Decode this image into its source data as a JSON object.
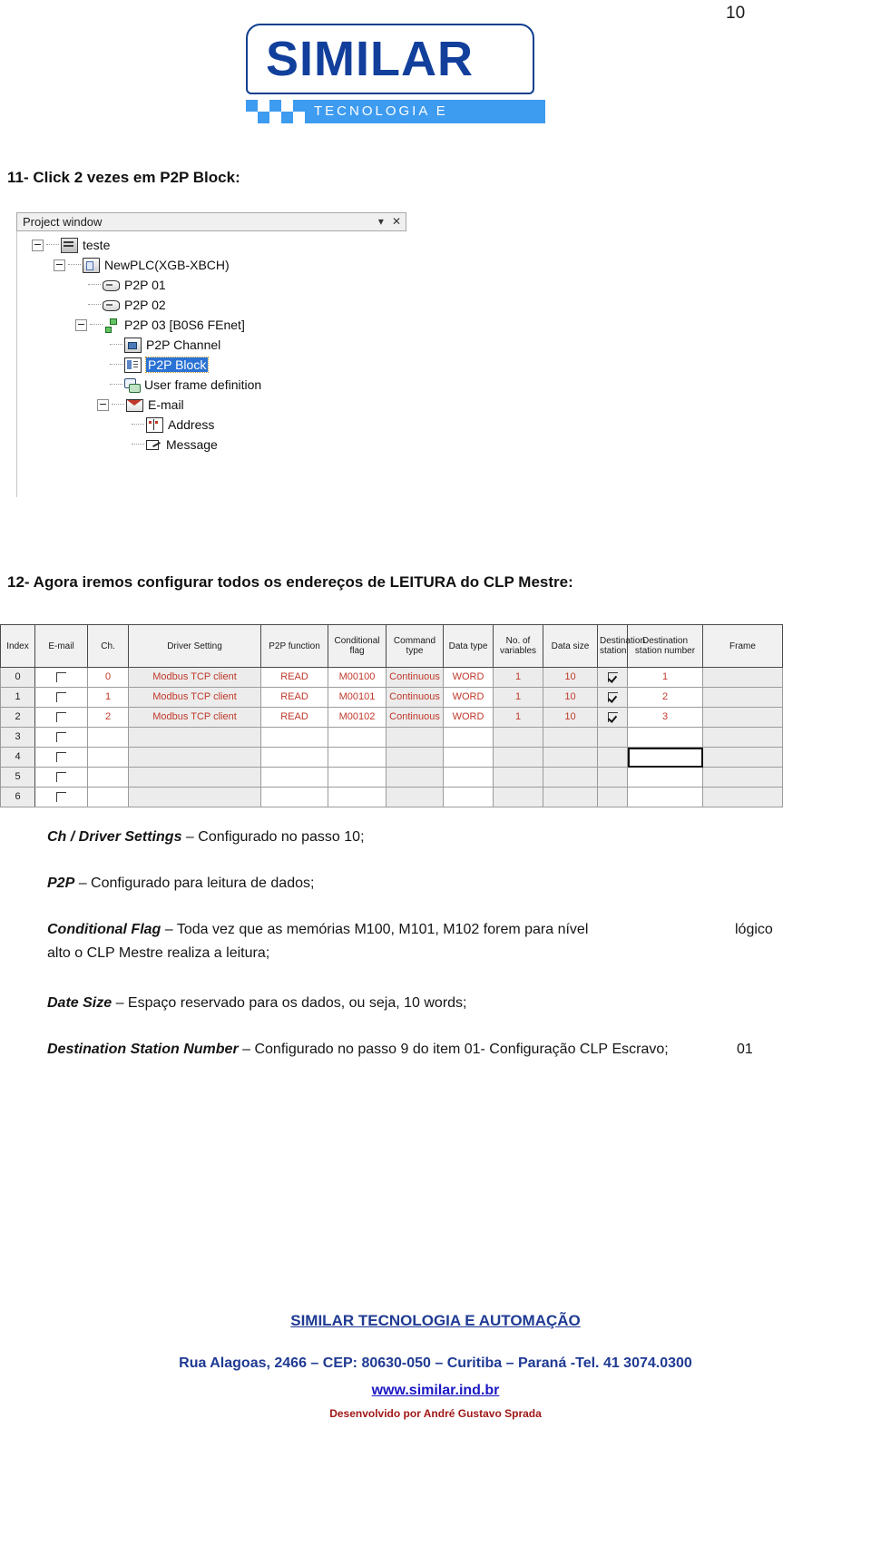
{
  "page": {
    "number": "10"
  },
  "logo": {
    "wordmark": "SIMILAR",
    "tagline": "TECNOLOGIA  E  AUTOMAÇÃO"
  },
  "steps": {
    "step11": "11- Click 2 vezes em P2P Block:",
    "step12": "12- Agora iremos configurar todos os endereços de LEITURA do CLP Mestre:"
  },
  "project_window": {
    "title": "Project window",
    "dropdown_glyph": "▾",
    "close_glyph": "✕",
    "tree": [
      {
        "label": "teste",
        "depth": 0,
        "expander": true,
        "icon": "rack-icon",
        "selected": false
      },
      {
        "label": "NewPLC(XGB-XBCH)",
        "depth": 1,
        "expander": true,
        "icon": "plc-icon",
        "selected": false
      },
      {
        "label": "P2P 01",
        "depth": 2,
        "expander": false,
        "icon": "card-icon",
        "selected": false
      },
      {
        "label": "P2P 02",
        "depth": 2,
        "expander": false,
        "icon": "card-icon",
        "selected": false
      },
      {
        "label": "P2P 03 [B0S6 FEnet]",
        "depth": 2,
        "expander": true,
        "icon": "network-icon",
        "selected": false
      },
      {
        "label": "P2P Channel",
        "depth": 3,
        "expander": false,
        "icon": "channel-icon",
        "selected": false
      },
      {
        "label": "P2P Block",
        "depth": 3,
        "expander": false,
        "icon": "block-icon",
        "selected": true
      },
      {
        "label": "User frame definition",
        "depth": 3,
        "expander": false,
        "icon": "frame-icon",
        "selected": false
      },
      {
        "label": "E-mail",
        "depth": 3,
        "expander": true,
        "icon": "mail-icon",
        "selected": false
      },
      {
        "label": "Address",
        "depth": 4,
        "expander": false,
        "icon": "address-icon",
        "selected": false
      },
      {
        "label": "Message",
        "depth": 4,
        "expander": false,
        "icon": "message-icon",
        "selected": false
      }
    ]
  },
  "grid": {
    "columns": [
      "Index",
      "E-mail",
      "Ch.",
      "Driver Setting",
      "P2P function",
      "Conditional flag",
      "Command type",
      "Data type",
      "No. of variables",
      "Data size",
      "Destination station",
      "Destination station number",
      "Frame"
    ],
    "rows": [
      {
        "index": "0",
        "email": false,
        "ch": "0",
        "driver": "Modbus TCP client",
        "p2p": "READ",
        "flag": "M00100",
        "command": "Continuous",
        "datatype": "WORD",
        "numvars": "1",
        "datasize": "10",
        "deststation": true,
        "deststationnum": "1",
        "frame": ""
      },
      {
        "index": "1",
        "email": false,
        "ch": "1",
        "driver": "Modbus TCP client",
        "p2p": "READ",
        "flag": "M00101",
        "command": "Continuous",
        "datatype": "WORD",
        "numvars": "1",
        "datasize": "10",
        "deststation": true,
        "deststationnum": "2",
        "frame": ""
      },
      {
        "index": "2",
        "email": false,
        "ch": "2",
        "driver": "Modbus TCP client",
        "p2p": "READ",
        "flag": "M00102",
        "command": "Continuous",
        "datatype": "WORD",
        "numvars": "1",
        "datasize": "10",
        "deststation": true,
        "deststationnum": "3",
        "frame": ""
      },
      {
        "index": "3",
        "email": false,
        "ch": "",
        "driver": "",
        "p2p": "",
        "flag": "",
        "command": "",
        "datatype": "",
        "numvars": "",
        "datasize": "",
        "deststation": false,
        "deststationnum": "",
        "frame": ""
      },
      {
        "index": "4",
        "email": false,
        "ch": "",
        "driver": "",
        "p2p": "",
        "flag": "",
        "command": "",
        "datatype": "",
        "numvars": "",
        "datasize": "",
        "deststation": false,
        "deststationnum": "",
        "frame": ""
      },
      {
        "index": "5",
        "email": false,
        "ch": "",
        "driver": "",
        "p2p": "",
        "flag": "",
        "command": "",
        "datatype": "",
        "numvars": "",
        "datasize": "",
        "deststation": false,
        "deststationnum": "",
        "frame": ""
      },
      {
        "index": "6",
        "email": false,
        "ch": "",
        "driver": "",
        "p2p": "",
        "flag": "",
        "command": "",
        "datatype": "",
        "numvars": "",
        "datasize": "",
        "deststation": false,
        "deststationnum": "",
        "frame": ""
      }
    ],
    "focused_cell": {
      "row": 4,
      "column": "Destination station number"
    }
  },
  "descriptions": {
    "ch_driver_term": "Ch / Driver Settings",
    "ch_driver_text": " – Configurado no passo 10;",
    "p2p_term": "P2P",
    "p2p_text": " – Configurado para leitura de dados;",
    "cond_term": "Conditional Flag",
    "cond_text": " – Toda vez que as memórias M100, M101, M102 forem para nível",
    "cond_tail": "lógico",
    "cond_line2": "alto o CLP Mestre realiza a leitura;",
    "date_term": "Date Size",
    "date_text": " – Espaço reservado para os dados, ou seja, 10 words;",
    "dest_term": "Destination Station Number",
    "dest_text": " –  Configurado no passo 9 do item 01- Configuração CLP",
    "dest_tail": "01",
    "dest_line2": "Escravo;"
  },
  "footer": {
    "company": "SIMILAR TECNOLOGIA E AUTOMAÇÃO",
    "address": "Rua Alagoas, 2466 – CEP: 80630-050 – Curitiba – Paraná -Tel. 41 3074.0300",
    "website": "www.similar.ind.br",
    "developer": "Desenvolvido por André Gustavo Sprada"
  },
  "colors": {
    "brand_blue": "#123f9b",
    "accent_blue": "#3d9bf0",
    "footer_blue": "#1f3a93",
    "link_blue": "#1a17c4",
    "grid_red": "#c0392b",
    "selection_blue": "#2a72d4"
  }
}
